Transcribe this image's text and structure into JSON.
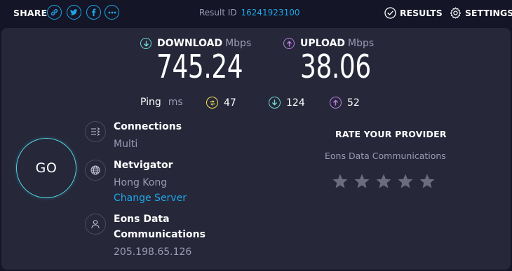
{
  "topbar": {
    "share_label": "SHARE",
    "share_icons": [
      "link-icon",
      "twitter-icon",
      "facebook-icon",
      "more-icon"
    ],
    "result_label": "Result ID",
    "result_id": "16241923100",
    "results_label": "RESULTS",
    "settings_label": "SETTINGS"
  },
  "download": {
    "label": "DOWNLOAD",
    "unit": "Mbps",
    "value": "745.24"
  },
  "upload": {
    "label": "UPLOAD",
    "unit": "Mbps",
    "value": "38.06"
  },
  "ping": {
    "label": "Ping",
    "unit": "ms",
    "idle": "47",
    "down": "124",
    "up": "52"
  },
  "go_label": "GO",
  "connections": {
    "title": "Connections",
    "value": "Multi"
  },
  "server": {
    "title": "Netvigator",
    "location": "Hong Kong",
    "change_label": "Change Server"
  },
  "isp": {
    "title_line1": "Eons Data",
    "title_line2": "Communications",
    "ip": "205.198.65.126"
  },
  "rate": {
    "title": "RATE YOUR PROVIDER",
    "provider": "Eons Data Communications",
    "stars_total": 5,
    "stars_selected": 0
  },
  "colors": {
    "background": "#141526",
    "panel": "#262739",
    "accent_blue": "#1ea7e8",
    "download": "#6fd9d4",
    "upload": "#b77fe0",
    "ping_idle": "#f5e15a",
    "go_ring": "#4ed8e6",
    "muted_text": "#9b9bb4"
  }
}
